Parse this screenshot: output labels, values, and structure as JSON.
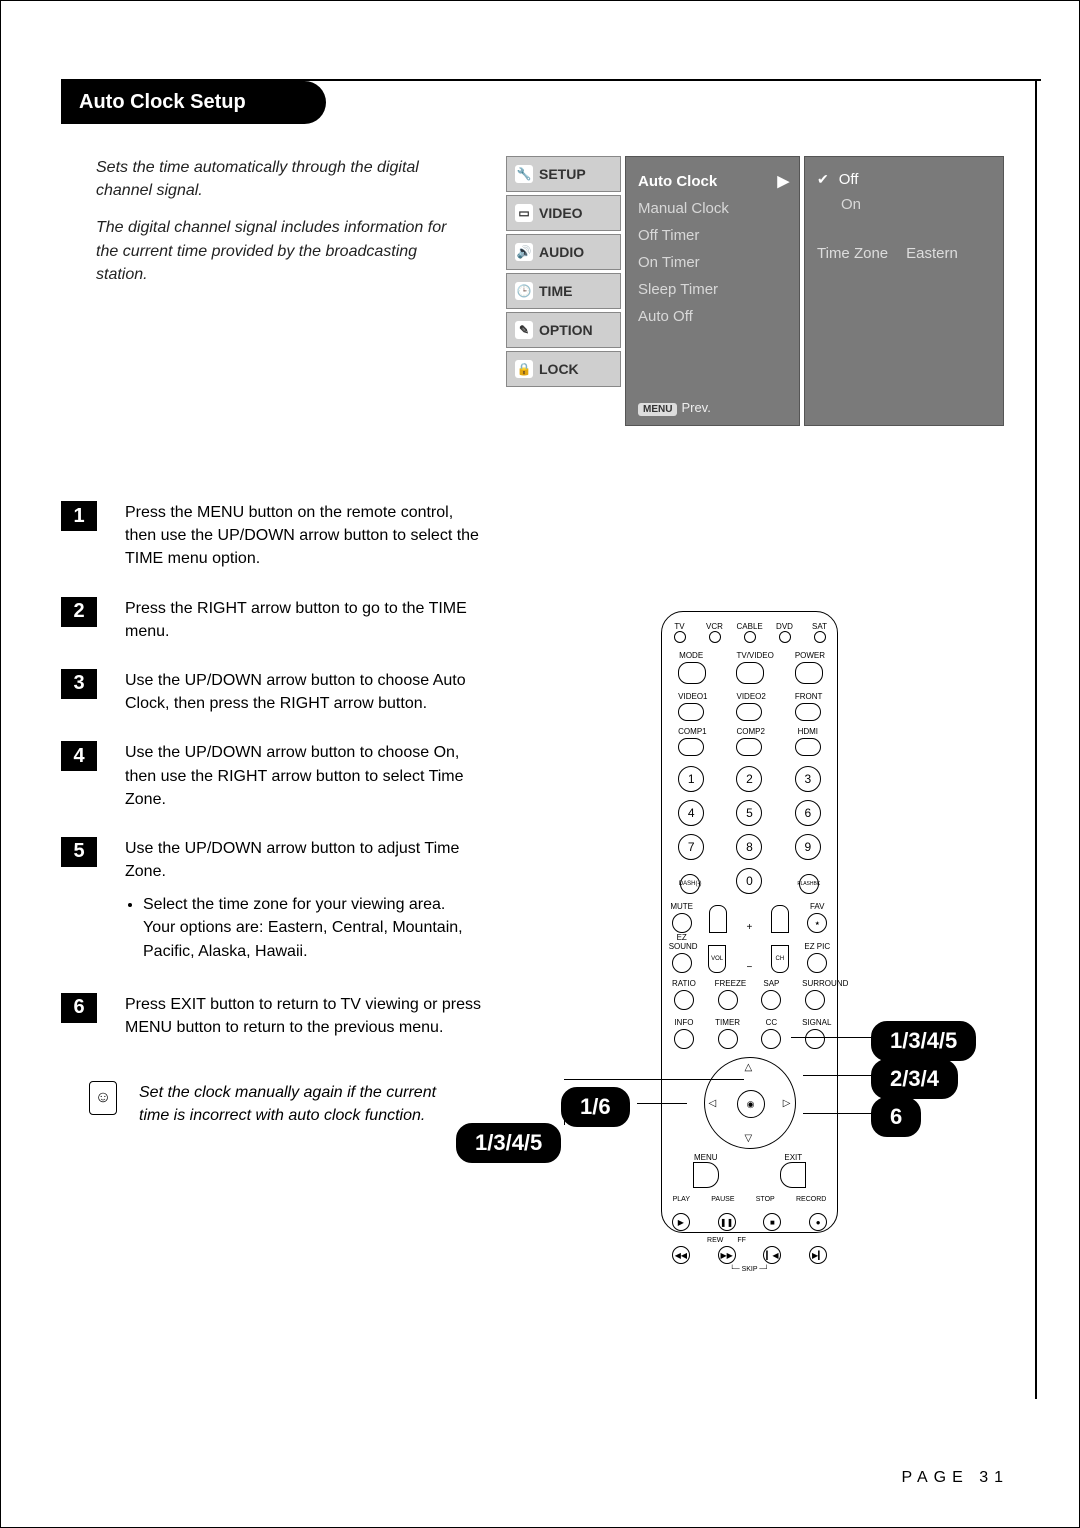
{
  "title": "Auto Clock Setup",
  "intro": {
    "p1": "Sets the time automatically through the digital channel signal.",
    "p2": "The digital channel signal includes information for the current time provided by the broadcasting station."
  },
  "osd": {
    "left_tabs": [
      "SETUP",
      "VIDEO",
      "AUDIO",
      "TIME",
      "OPTION",
      "LOCK"
    ],
    "mid_items": [
      "Auto Clock",
      "Manual Clock",
      "Off Timer",
      "On Timer",
      "Sleep Timer",
      "Auto Off"
    ],
    "mid_selected": "Auto Clock",
    "mid_footer_badge": "MENU",
    "mid_footer_text": "Prev.",
    "right": {
      "options": [
        "Off",
        "On"
      ],
      "selected": "Off",
      "tz_label": "Time Zone",
      "tz_value": "Eastern"
    },
    "arrow": "▶",
    "check": "✔"
  },
  "steps": [
    {
      "n": "1",
      "t": "Press the MENU button on the remote control, then use the UP/DOWN arrow button to select the TIME menu option."
    },
    {
      "n": "2",
      "t": "Press the RIGHT arrow button to go to the TIME menu."
    },
    {
      "n": "3",
      "t": "Use the UP/DOWN arrow button to choose Auto Clock, then press the RIGHT arrow button."
    },
    {
      "n": "4",
      "t": "Use the UP/DOWN arrow button to choose On, then use the RIGHT arrow button to select Time Zone."
    },
    {
      "n": "5",
      "t": "Use the UP/DOWN arrow button to adjust Time Zone.",
      "bullet": "Select the time zone for your viewing area. Your options are: Eastern, Central, Mountain, Pacific, Alaska, Hawaii."
    },
    {
      "n": "6",
      "t": "Press EXIT button to return to TV viewing or press MENU button to return to the previous menu."
    }
  ],
  "note": "Set the clock manually again if the current time is incorrect with auto clock function.",
  "remote": {
    "top_leds": [
      "TV",
      "VCR",
      "CABLE",
      "DVD",
      "SAT"
    ],
    "row2": [
      "MODE",
      "TV/VIDEO",
      "POWER"
    ],
    "row3": [
      "VIDEO1",
      "VIDEO2",
      "FRONT"
    ],
    "row4": [
      "COMP1",
      "COMP2",
      "HDMI"
    ],
    "digits": [
      "1",
      "2",
      "3",
      "4",
      "5",
      "6",
      "7",
      "8",
      "9",
      "DASH(-)",
      "0",
      "FLASHBK"
    ],
    "row_mid_labels_left": "MUTE",
    "row_mid_labels_right": "FAV",
    "row_mid_left2": "EZ SOUND",
    "row_mid_right2": "EZ PIC",
    "vol_label": "VOL",
    "ch_label": "CH",
    "row_under_pad": [
      "RATIO",
      "FREEZE",
      "SAP",
      "SURROUND"
    ],
    "row_info": [
      "INFO",
      "TIMER",
      "CC",
      "SIGNAL"
    ],
    "menu": "MENU",
    "exit": "EXIT",
    "transport": [
      "PLAY",
      "PAUSE",
      "STOP",
      "RECORD"
    ],
    "transport2": [
      "REW",
      "FF"
    ],
    "skip": "SKIP"
  },
  "callouts": {
    "a": "1/3/4/5",
    "b": "2/3/4",
    "c": "6",
    "d": "1/6",
    "e": "1/3/4/5"
  },
  "page_number": "PAGE 31"
}
